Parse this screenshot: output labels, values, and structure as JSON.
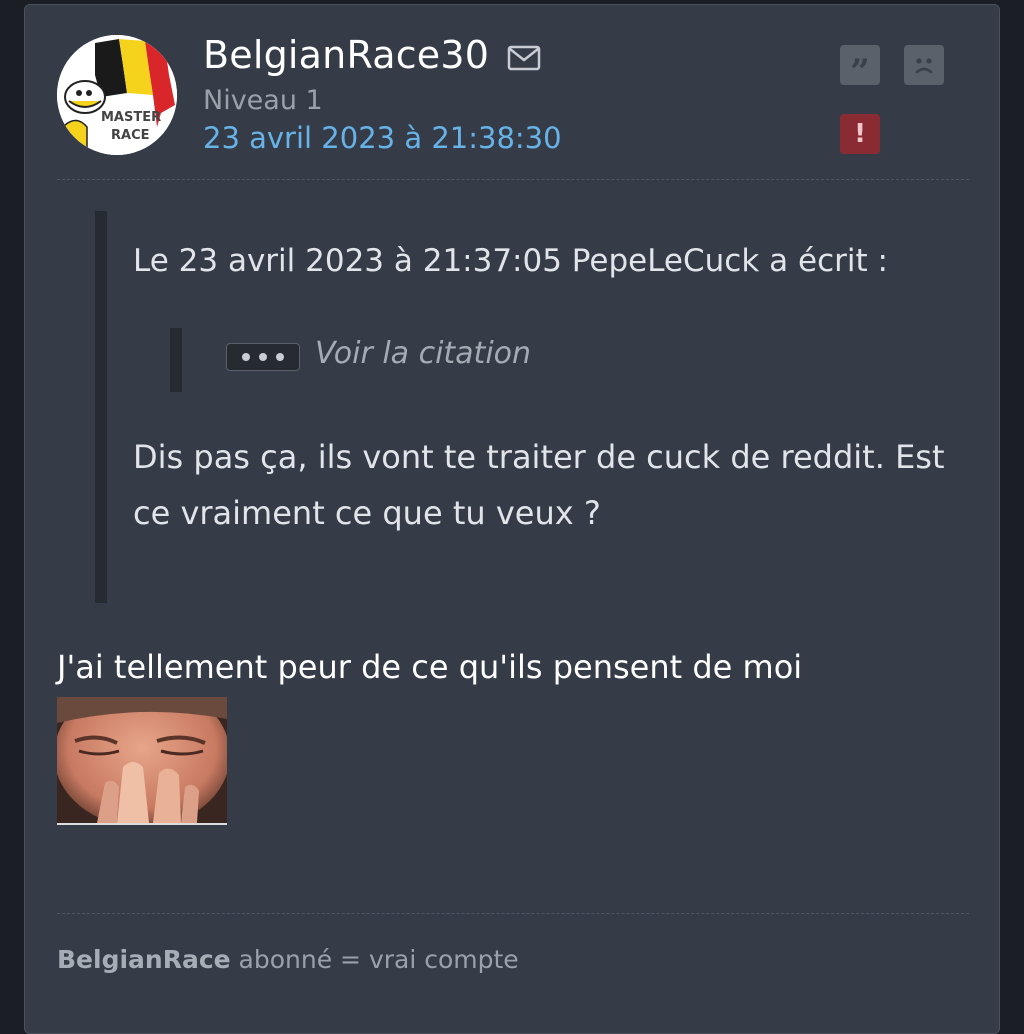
{
  "author": {
    "username": "BelgianRace30",
    "level": "Niveau 1",
    "date": "23 avril 2023 à 21:38:30",
    "avatar_text": [
      "MASTER",
      "RACE"
    ]
  },
  "icons": {
    "mail": "mail-icon",
    "quote": "quote-icon",
    "sad": "sad-face-icon",
    "report": "exclamation-icon"
  },
  "colors": {
    "card_bg": "#353c48",
    "page_bg": "#1b1e24",
    "link": "#67b3e8",
    "report": "#8a2a33",
    "action": "#5b616b"
  },
  "quote": {
    "header": "Le 23 avril 2023 à 21:37:05 PepeLeCuck a écrit :",
    "nested_label": "Voir la citation",
    "body": "Dis pas ça, ils vont te traiter de cuck de reddit. Est ce vraiment ce que tu veux ?"
  },
  "message": {
    "text": "J'ai tellement peur de ce qu'ils pensent de moi"
  },
  "signature": {
    "bold": "BelgianRace",
    "rest": " abonné = vrai compte"
  }
}
